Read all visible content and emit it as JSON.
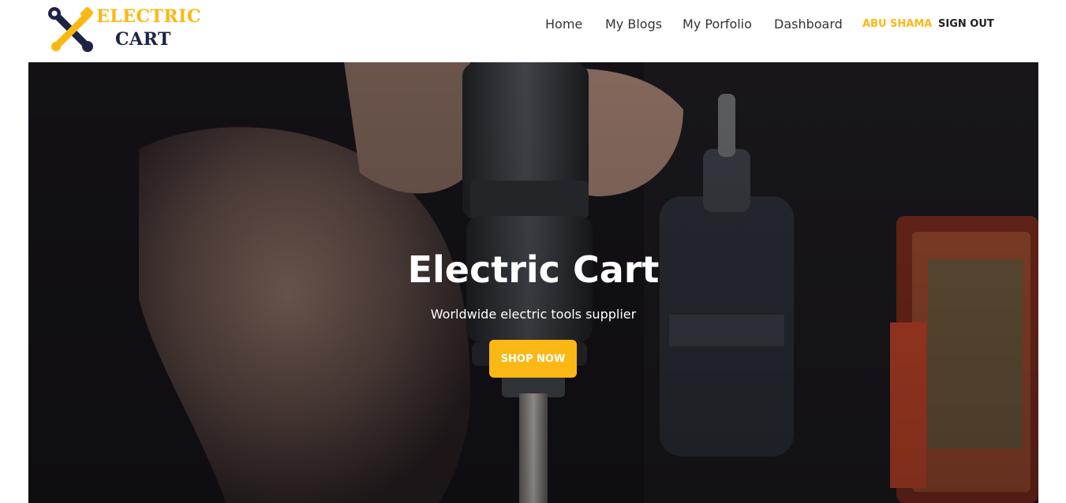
{
  "brand": {
    "logo_line1": "ELECTRIC",
    "logo_line2": "CART",
    "icon": "crossed-tools-icon"
  },
  "nav": {
    "links": [
      "Home",
      "My Blogs",
      "My Porfolio",
      "Dashboard"
    ],
    "user_name": "ABU SHAMA",
    "sign_out": "SIGN OUT"
  },
  "hero": {
    "title": "Electric Cart",
    "subtitle": "Worldwide electric tools supplier",
    "cta": "SHOP NOW"
  },
  "colors": {
    "accent": "#fbb814",
    "logo_dark": "#1d2345",
    "nav_text": "#333333",
    "hero_dark": "#17151a"
  }
}
